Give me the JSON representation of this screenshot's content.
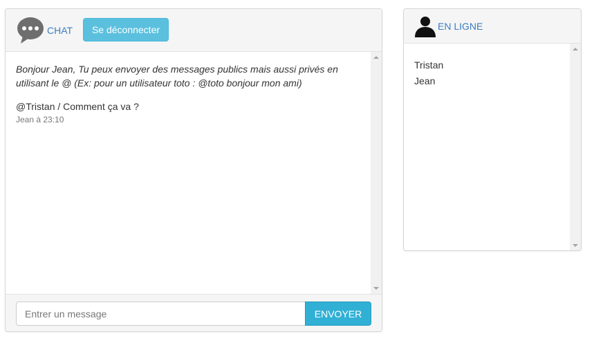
{
  "chat": {
    "title": "CHAT",
    "logout_label": "Se déconnecter",
    "system_message": "Bonjour Jean, Tu peux envoyer des messages publics mais aussi privés en utilisant le @ (Ex: pour un utilisateur toto : @toto bonjour mon ami)",
    "messages": [
      {
        "text": "@Tristan / Comment ça va ?",
        "meta": "Jean à 23:10"
      }
    ],
    "input_placeholder": "Entrer un message",
    "send_label": "ENVOYER",
    "icon": "chat-bubble-icon"
  },
  "online": {
    "title": "EN LIGNE",
    "icon": "user-silhouette-icon",
    "users": [
      "Tristan",
      "Jean"
    ]
  },
  "colors": {
    "accent_text": "#3a7dc0",
    "logout_button": "#5bc0de",
    "send_button": "#31b0d5"
  }
}
